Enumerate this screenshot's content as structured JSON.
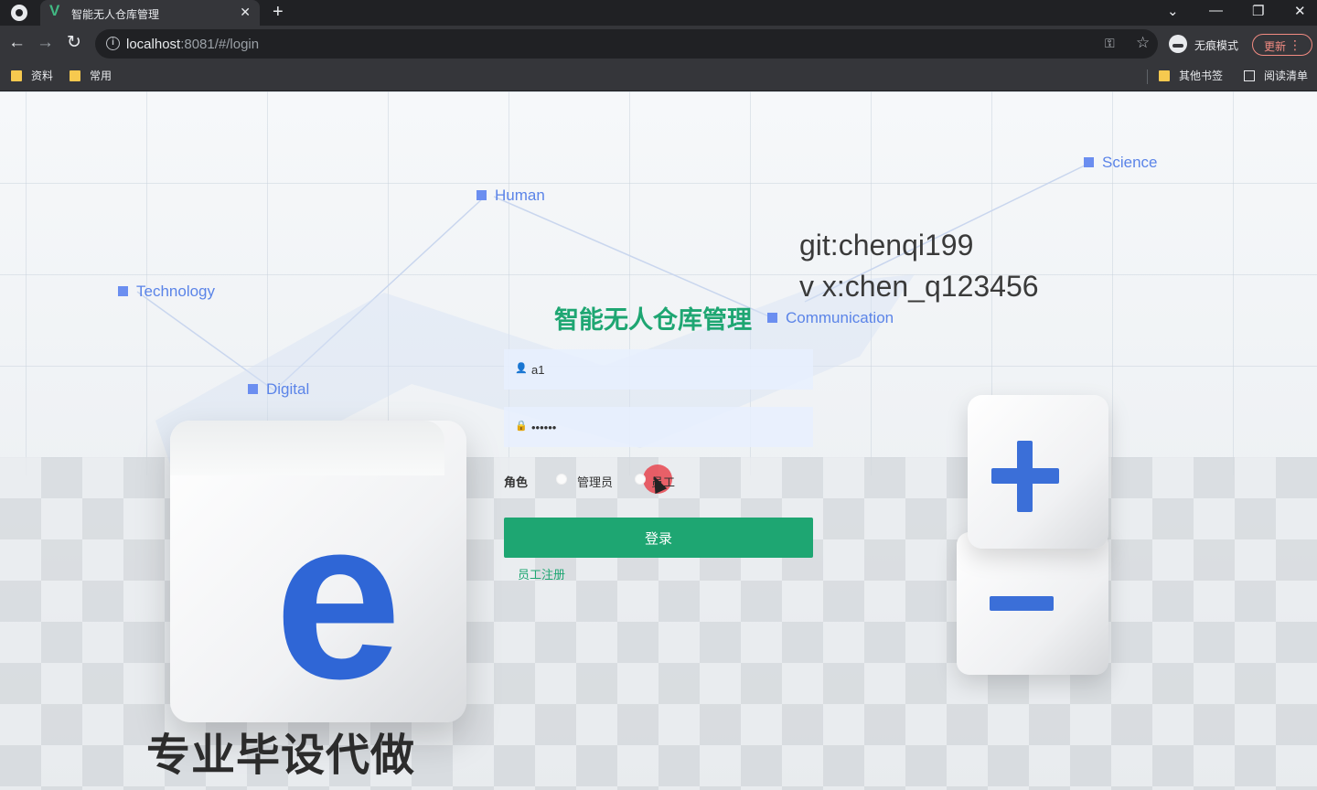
{
  "browser": {
    "tab_title": "智能无人仓库管理",
    "tab_favicon": "V",
    "url_host": "localhost",
    "url_rest": ":8081/#/login",
    "incognito_label": "无痕模式",
    "update_label": "更新",
    "bookmarks": [
      "资料",
      "常用"
    ],
    "other_bookmarks": "其他书签",
    "reading_list": "阅读清单"
  },
  "background": {
    "tags": [
      "Science",
      "Human",
      "Technology",
      "Communication",
      "Digital"
    ],
    "watermark_line1": "git:chenqi199",
    "watermark_line2": "v x:chen_q123456",
    "watermark_big": "专业毕设代做",
    "cube_letter": "e"
  },
  "login": {
    "title": "智能无人仓库管理",
    "username_value": "a1",
    "password_value": "••••••",
    "role_label": "角色",
    "roles": [
      "管理员",
      "员工"
    ],
    "submit_label": "登录",
    "register_link": "员工注册"
  },
  "colors": {
    "accent": "#1ea672",
    "tag_blue": "#5b84e8",
    "cube_blue": "#3b6fd8"
  }
}
